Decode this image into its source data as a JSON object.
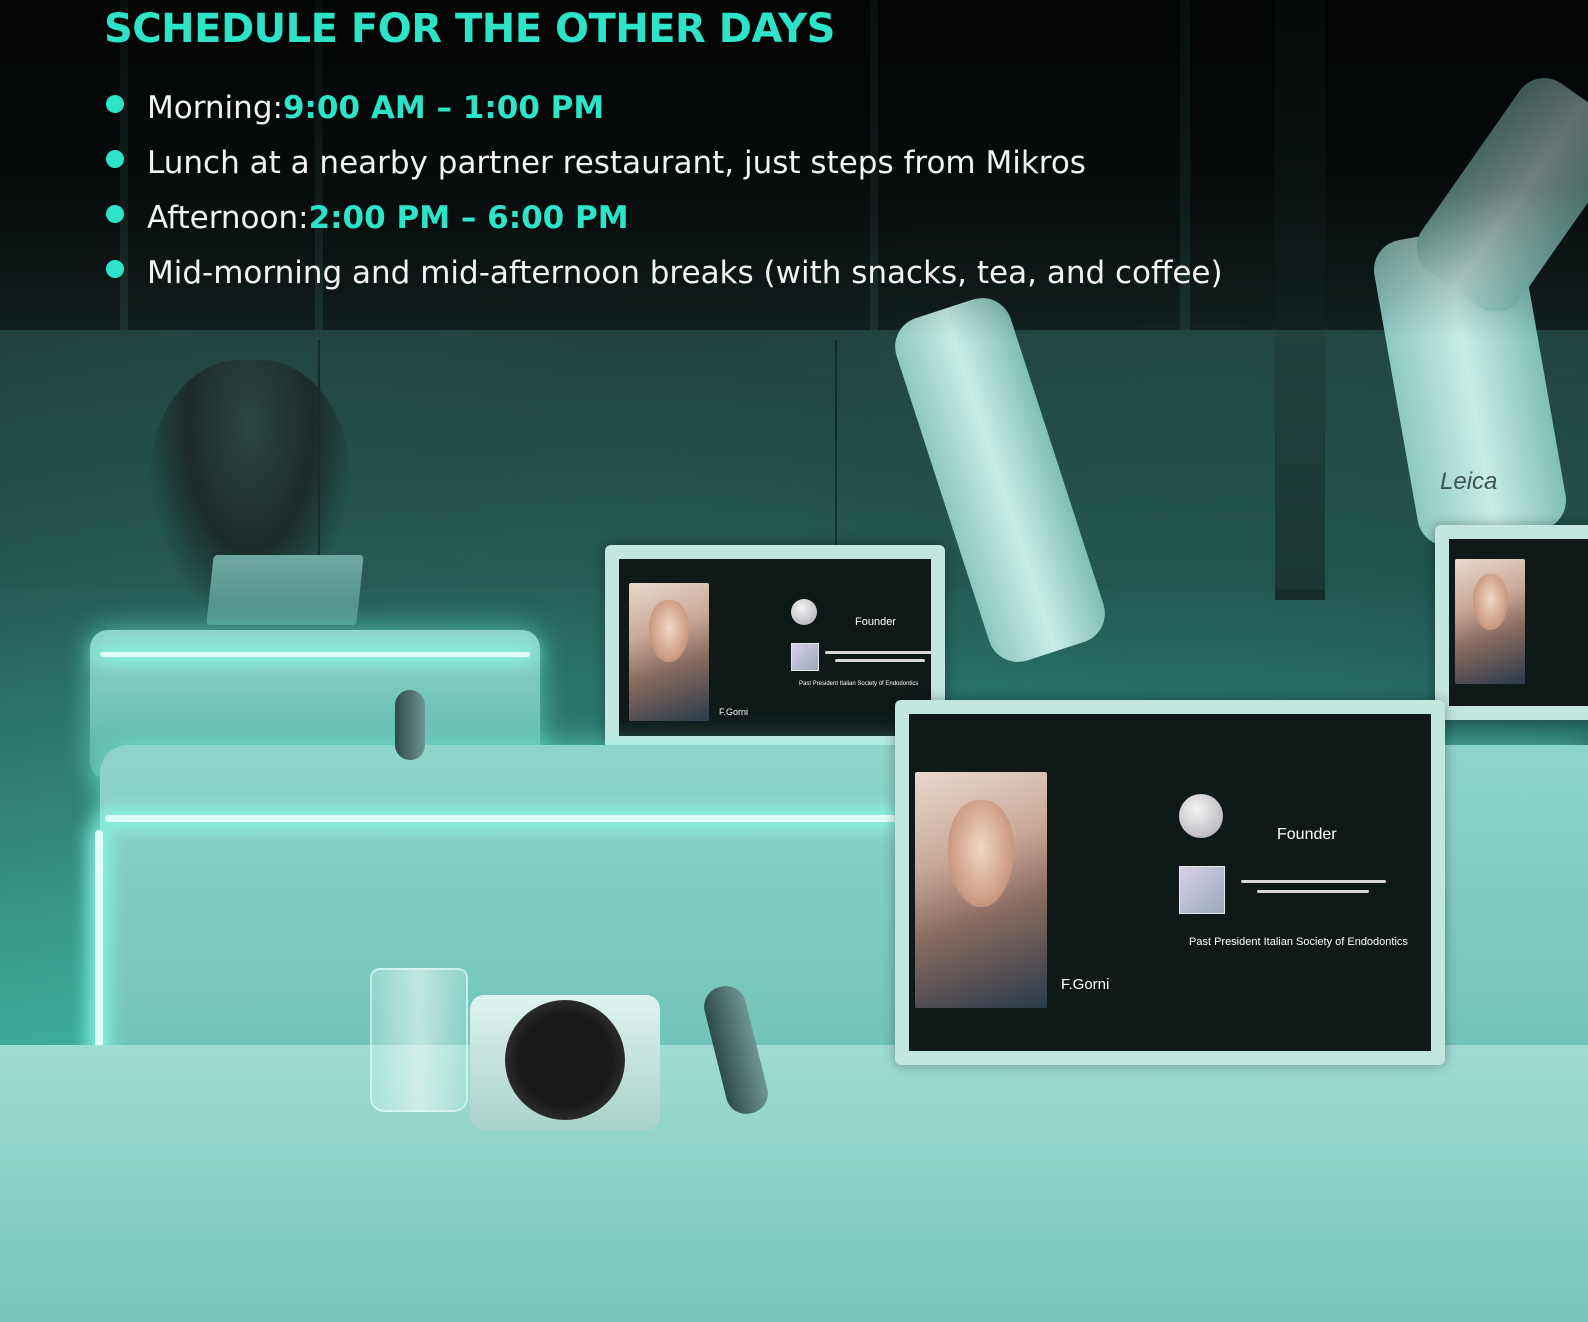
{
  "heading": "SCHEDULE FOR THE OTHER DAYS",
  "schedule": [
    {
      "label": "Morning: ",
      "highlight": "9:00 AM – 1:00 PM"
    },
    {
      "label": "Lunch at a nearby partner restaurant, just steps from Mikros",
      "highlight": ""
    },
    {
      "label": "Afternoon: ",
      "highlight": "2:00 PM – 6:00 PM"
    },
    {
      "label": "Mid-morning and mid-afternoon breaks (with snacks, tea, and coffee)",
      "highlight": ""
    }
  ],
  "photo": {
    "screen_caption_name": "F.Gorni",
    "screen_caption_role": "Founder",
    "screen_caption_society": "Past President Italian Society of Endodontics",
    "microscope_brand": "Leica"
  },
  "colors": {
    "accent": "#2de3c8",
    "text": "#f2f2f2",
    "background": "#0d1716"
  }
}
